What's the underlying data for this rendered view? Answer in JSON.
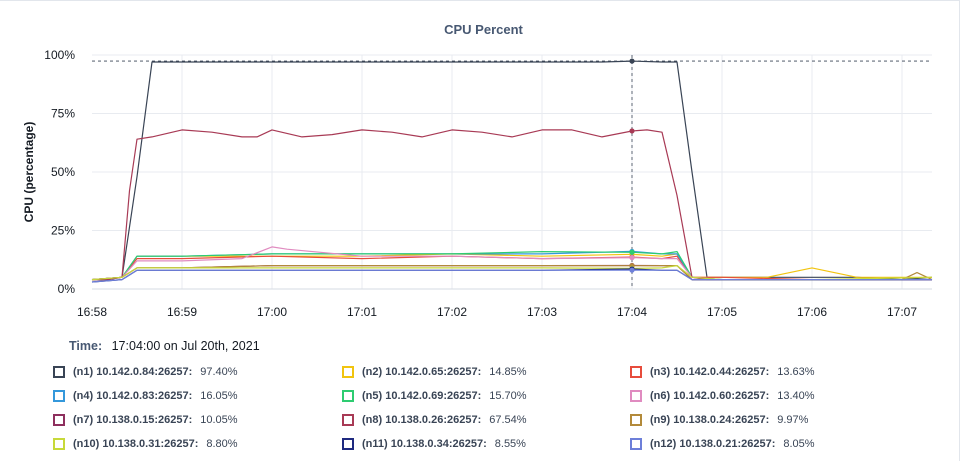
{
  "chart_title": "CPU Percent",
  "time_label": "Time:",
  "time_value": "17:04:00 on Jul 20th, 2021",
  "chart_data": {
    "type": "line",
    "title": "CPU Percent",
    "ylabel": "CPU (percentage)",
    "xlabel": "",
    "ylim": [
      0,
      100
    ],
    "xlim": [
      0,
      560
    ],
    "y_ticks": [
      0,
      25,
      50,
      75,
      100
    ],
    "y_tick_labels": [
      "0%",
      "25%",
      "50%",
      "75%",
      "100%"
    ],
    "x_ticks": [
      0,
      60,
      120,
      180,
      240,
      300,
      360,
      420,
      480
    ],
    "x_tick_labels": [
      "16:58",
      "16:59",
      "17:00",
      "17:01",
      "17:02",
      "17:03",
      "17:04",
      "17:05",
      "17:06",
      "17:07"
    ],
    "x_tick_seconds": [
      0,
      60,
      120,
      180,
      240,
      300,
      360,
      420,
      480,
      540
    ],
    "x_unit": "seconds after 16:58",
    "crosshair_x": 360,
    "ref_line_y": 97.4,
    "grid": true,
    "legend_placement": "bottom",
    "series": [
      {
        "name": "(n1) 10.142.0.84:26257:",
        "value_label": "97.40%",
        "color": "#394455",
        "x": [
          0,
          10,
          20,
          30,
          40,
          50,
          60,
          80,
          100,
          120,
          140,
          160,
          180,
          200,
          220,
          240,
          260,
          280,
          300,
          320,
          340,
          360,
          380,
          390,
          400,
          410,
          420,
          450,
          480,
          510,
          540,
          560
        ],
        "y": [
          4,
          4,
          5,
          48,
          97,
          97,
          97,
          97,
          97,
          97,
          97,
          97,
          97,
          97,
          97,
          97,
          97,
          97,
          97,
          97,
          97,
          97.4,
          97,
          97,
          50,
          5,
          5,
          5,
          5,
          5,
          4,
          5
        ]
      },
      {
        "name": "(n2) 10.142.0.65:26257:",
        "value_label": "14.85%",
        "color": "#f1c40f",
        "x": [
          0,
          20,
          30,
          60,
          120,
          180,
          240,
          300,
          360,
          380,
          390,
          400,
          420,
          450,
          480,
          510,
          540,
          560
        ],
        "y": [
          4,
          5,
          14,
          14,
          14,
          14,
          15,
          14,
          14.85,
          14,
          15,
          5,
          5,
          5,
          9,
          5,
          5,
          5
        ]
      },
      {
        "name": "(n3) 10.142.0.44:26257:",
        "value_label": "13.63%",
        "color": "#e74c3c",
        "x": [
          0,
          20,
          30,
          60,
          120,
          180,
          240,
          300,
          360,
          380,
          390,
          400,
          420,
          480,
          560
        ],
        "y": [
          4,
          5,
          13,
          13,
          14,
          13,
          14,
          13,
          13.63,
          13,
          14,
          5,
          5,
          4,
          4
        ]
      },
      {
        "name": "(n4) 10.142.0.83:26257:",
        "value_label": "16.05%",
        "color": "#3498db",
        "x": [
          0,
          20,
          30,
          60,
          120,
          180,
          240,
          300,
          360,
          380,
          390,
          400,
          420,
          480,
          560
        ],
        "y": [
          4,
          5,
          14,
          14,
          15,
          15,
          15,
          15,
          16.05,
          15,
          15,
          5,
          4,
          4,
          4
        ]
      },
      {
        "name": "(n5) 10.142.0.69:26257:",
        "value_label": "15.70%",
        "color": "#2ecc71",
        "x": [
          0,
          20,
          30,
          60,
          120,
          180,
          240,
          300,
          360,
          380,
          390,
          400,
          420,
          480,
          560
        ],
        "y": [
          4,
          5,
          14,
          14,
          15,
          15,
          15,
          16,
          15.7,
          15,
          16,
          5,
          4,
          4,
          4
        ]
      },
      {
        "name": "(n6) 10.142.0.60:26257:",
        "value_label": "13.40%",
        "color": "#e08bc0",
        "x": [
          0,
          20,
          30,
          60,
          100,
          120,
          130,
          180,
          240,
          300,
          360,
          380,
          390,
          400,
          420,
          480,
          560
        ],
        "y": [
          4,
          5,
          12,
          12,
          13,
          18,
          17,
          14,
          14,
          13,
          13.4,
          13,
          13,
          5,
          4,
          4,
          4
        ]
      },
      {
        "name": "(n7) 10.138.0.15:26257:",
        "value_label": "10.05%",
        "color": "#8e2f5e",
        "x": [
          0,
          20,
          30,
          60,
          120,
          180,
          240,
          300,
          360,
          380,
          390,
          400,
          420,
          480,
          560
        ],
        "y": [
          4,
          5,
          9,
          9,
          10,
          10,
          10,
          10,
          10.05,
          10,
          10,
          4,
          4,
          4,
          4
        ]
      },
      {
        "name": "(n8) 10.138.0.26:26257:",
        "value_label": "67.54%",
        "color": "#a83a55",
        "x": [
          0,
          10,
          20,
          25,
          30,
          40,
          60,
          80,
          100,
          110,
          120,
          140,
          160,
          180,
          200,
          220,
          240,
          260,
          280,
          300,
          320,
          340,
          360,
          370,
          380,
          390,
          400,
          410,
          420,
          480,
          560
        ],
        "y": [
          4,
          4,
          5,
          42,
          64,
          65,
          68,
          67,
          65,
          65,
          68,
          65,
          66,
          68,
          67,
          65,
          68,
          67,
          65,
          68,
          68,
          65,
          67.54,
          68,
          67,
          40,
          5,
          4,
          4,
          4,
          4
        ]
      },
      {
        "name": "(n9) 10.138.0.24:26257:",
        "value_label": "9.97%",
        "color": "#b38a3a",
        "x": [
          0,
          20,
          30,
          60,
          120,
          180,
          240,
          300,
          360,
          380,
          390,
          400,
          420,
          480,
          540,
          550,
          560
        ],
        "y": [
          4,
          5,
          9,
          9,
          10,
          10,
          10,
          10,
          9.97,
          10,
          10,
          4,
          4,
          4,
          4,
          7,
          4
        ]
      },
      {
        "name": "(n10) 10.138.0.31:26257:",
        "value_label": "8.80%",
        "color": "#c7d93a",
        "x": [
          0,
          20,
          30,
          60,
          120,
          180,
          240,
          300,
          360,
          380,
          390,
          400,
          420,
          480,
          560
        ],
        "y": [
          4,
          5,
          9,
          9,
          9,
          9,
          9,
          9,
          8.8,
          9,
          10,
          5,
          4,
          4,
          5
        ]
      },
      {
        "name": "(n11) 10.138.0.34:26257:",
        "value_label": "8.55%",
        "color": "#1f2a80",
        "x": [
          0,
          20,
          30,
          60,
          120,
          180,
          240,
          300,
          360,
          380,
          390,
          400,
          420,
          480,
          560
        ],
        "y": [
          3,
          4,
          8,
          8,
          8,
          8,
          8,
          8,
          8.55,
          8,
          8,
          4,
          4,
          4,
          4
        ]
      },
      {
        "name": "(n12) 10.138.0.21:26257:",
        "value_label": "8.05%",
        "color": "#6d7fd9",
        "x": [
          0,
          20,
          30,
          60,
          120,
          180,
          240,
          300,
          360,
          380,
          390,
          400,
          420,
          480,
          560
        ],
        "y": [
          3,
          4,
          8,
          8,
          8,
          8,
          8,
          8,
          8.05,
          8,
          8,
          4,
          4,
          4,
          4
        ]
      }
    ]
  }
}
